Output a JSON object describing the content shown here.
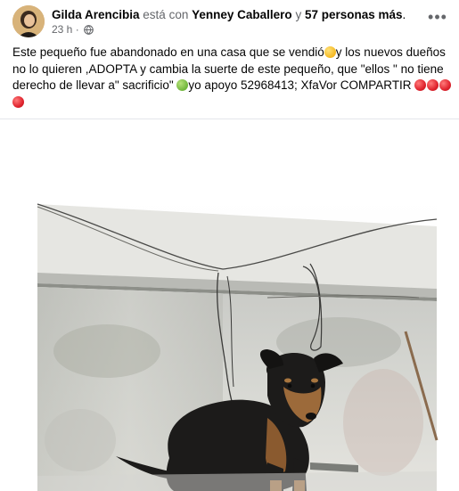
{
  "post": {
    "author": "Gilda Arencibia",
    "with_text": "está con",
    "tagged": "Yenney Caballero",
    "and_text": "y",
    "others": "57 personas más",
    "period": ".",
    "time": "23 h",
    "dot": "·",
    "text_part1": "Este pequeño fue abandonado en una casa que se vendió",
    "text_part2": "y los nuevos dueños no lo quieren ,ADOPTA y cambia la suerte de este pequeño, que \"ellos \" no tiene derecho de llevar a\" sacrificio\" ",
    "text_part3": "yo apoyo 52968413; XfaVor COMPARTIR "
  },
  "icons": {
    "more": "more-options-icon",
    "privacy": "globe-icon",
    "emoji_sad": "crying-face-emoji",
    "emoji_sick": "sick-face-emoji",
    "emoji_red": "red-circle-emoji"
  },
  "colors": {
    "text": "#050505",
    "muted": "#65676b",
    "divider": "#e4e6eb",
    "red_circle": "#e0242e"
  }
}
